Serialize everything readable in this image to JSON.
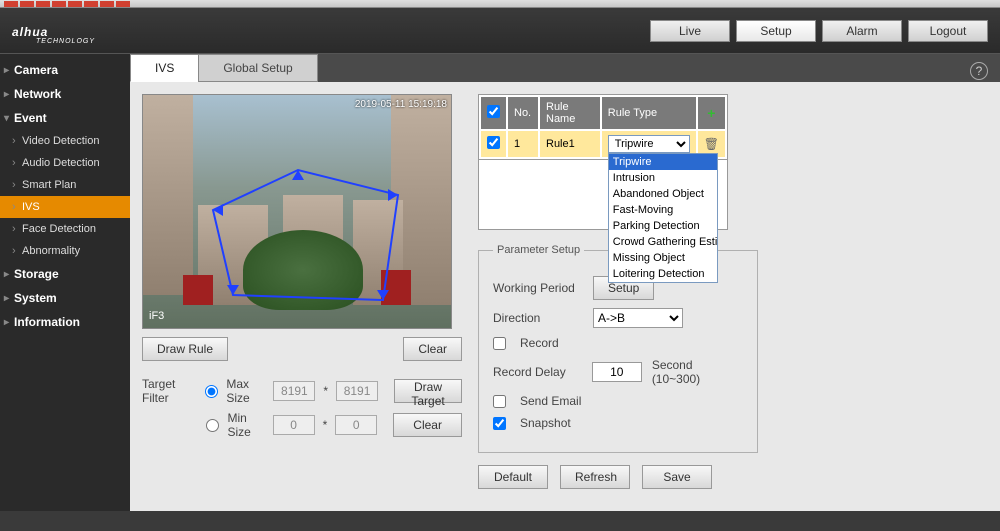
{
  "brand": {
    "name": "alhua",
    "sub": "TECHNOLOGY"
  },
  "nav": {
    "live": "Live",
    "setup": "Setup",
    "alarm": "Alarm",
    "logout": "Logout"
  },
  "sidebar": {
    "camera": "Camera",
    "network": "Network",
    "event": "Event",
    "video_detection": "Video Detection",
    "audio_detection": "Audio Detection",
    "smart_plan": "Smart Plan",
    "ivs": "IVS",
    "face_detection": "Face Detection",
    "abnormality": "Abnormality",
    "storage": "Storage",
    "system": "System",
    "information": "Information"
  },
  "tabs": {
    "ivs": "IVS",
    "global": "Global Setup"
  },
  "video": {
    "timestamp": "2019-05-11 15:19:18",
    "label": "iF3"
  },
  "buttons": {
    "draw_rule": "Draw Rule",
    "clear": "Clear",
    "draw_target": "Draw Target",
    "setup": "Setup",
    "default": "Default",
    "refresh": "Refresh",
    "save": "Save"
  },
  "filter": {
    "label": "Target Filter",
    "max": "Max Size",
    "min": "Min Size",
    "max_w": "8191",
    "max_h": "8191",
    "min_w": "0",
    "min_h": "0",
    "sep": "*"
  },
  "rules": {
    "hdr_no": "No.",
    "hdr_name": "Rule Name",
    "hdr_type": "Rule Type",
    "row": {
      "no": "1",
      "name": "Rule1",
      "type": "Tripwire"
    },
    "options": [
      "Tripwire",
      "Intrusion",
      "Abandoned Object",
      "Fast-Moving",
      "Parking Detection",
      "Crowd Gathering Estimation",
      "Missing Object",
      "Loitering Detection"
    ]
  },
  "param": {
    "legend": "Parameter Setup",
    "working_period": "Working Period",
    "direction": "Direction",
    "direction_val": "A->B",
    "record": "Record",
    "record_delay": "Record Delay",
    "record_delay_val": "10",
    "record_hint": "Second (10~300)",
    "send_email": "Send Email",
    "snapshot": "Snapshot"
  }
}
